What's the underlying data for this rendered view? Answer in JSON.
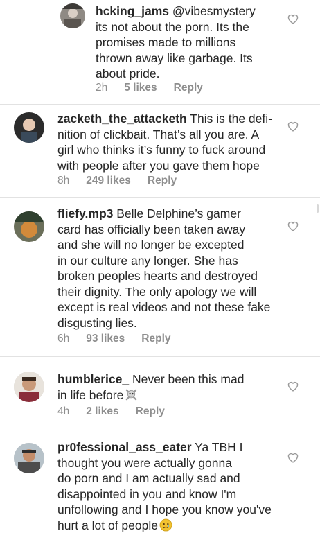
{
  "comments": [
    {
      "username": "hcking_jams",
      "text": " @vibesmystery\nits not about the porn. Its the\npromises made to millions\nthrown away like garbage. Its\nabout pride.",
      "time": "2h",
      "likes": "5 likes",
      "reply": "Reply"
    },
    {
      "username": "zacketh_the_attacketh",
      "text": " This is the defi-\nnition of clickbait. That’s all you are. A\ngirl who thinks it’s funny to fuck around\nwith people after you gave them hope",
      "time": "8h",
      "likes": "249 likes",
      "reply": "Reply"
    },
    {
      "username": "fliefy.mp3",
      "text": " Belle Delphine’s gamer\ncard has officially been taken away\nand she will no longer be excepted\nin our culture any longer. She has\nbroken peoples hearts and destroyed\ntheir dignity. The only apology we will\nexcept is real videos and not these fake\ndisgusting lies.",
      "time": "6h",
      "likes": "93 likes",
      "reply": "Reply"
    },
    {
      "username": "humblerice_",
      "text": " Never been this mad\nin life before",
      "emoji": "skull-and-crossbones-emoji",
      "time": "4h",
      "likes": "2 likes",
      "reply": "Reply"
    },
    {
      "username": "pr0fessional_ass_eater",
      "text": " Ya TBH I\nthought you were actually gonna\ndo porn and I am actually sad and\ndisappointed in you and know I'm\nunfollowing and I hope you know you've\nhurt a lot of people",
      "emoji": "crying-face-emoji"
    }
  ],
  "icons": {
    "like": "heart-outline-icon"
  },
  "colors": {
    "text": "#262626",
    "meta": "#8e8e8e",
    "divider": "#e2e2e2"
  }
}
